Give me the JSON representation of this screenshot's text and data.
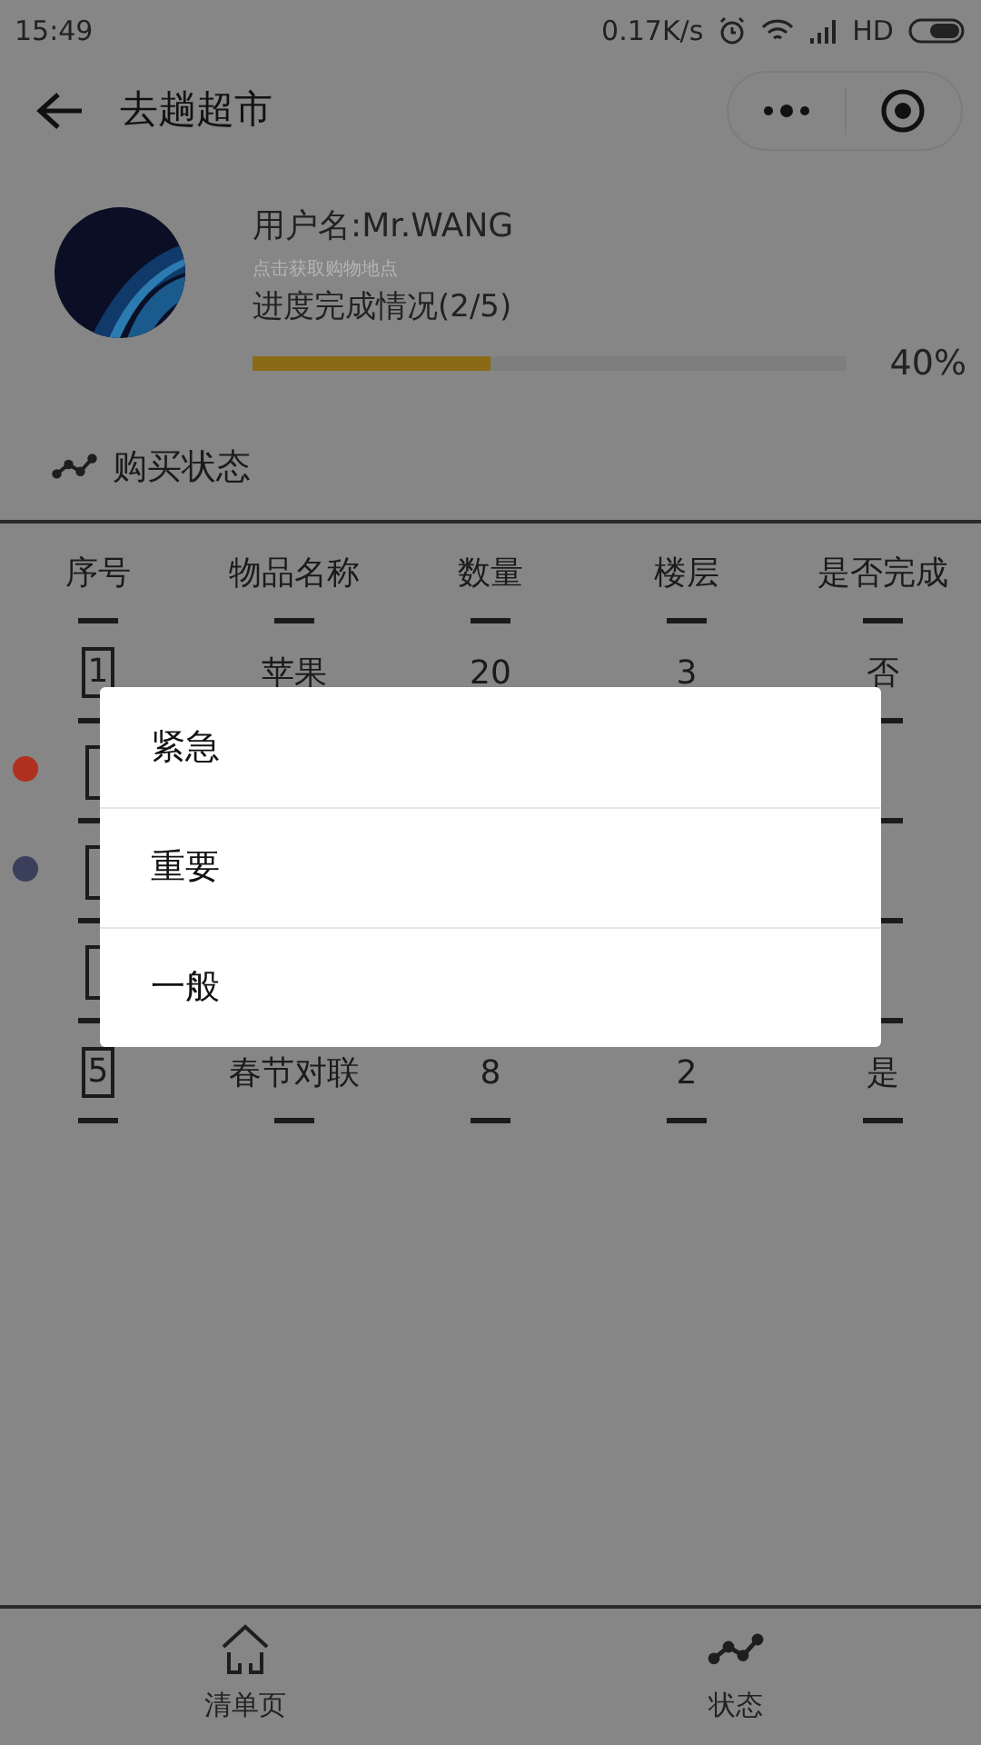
{
  "status_bar": {
    "time": "15:49",
    "speed": "0.17K/s",
    "network": "HD"
  },
  "nav": {
    "title": "去趟超市"
  },
  "profile": {
    "username": "用户名:Mr.WANG",
    "hint": "点击获取购物地点",
    "progress_label": "进度完成情况(2/5)",
    "level": 0.4,
    "percent": "40%"
  },
  "section": {
    "title": "购买状态"
  },
  "table": {
    "columns": [
      "序号",
      "物品名称",
      "数量",
      "楼层",
      "是否完成"
    ],
    "rows": [
      {
        "kind": "item",
        "index": "1",
        "name": "苹果",
        "qty": "20",
        "floor": "3",
        "done": "否"
      },
      {
        "kind": "covered",
        "color": "#b03020"
      },
      {
        "kind": "covered",
        "color": "#3a3f5c"
      },
      {
        "kind": "covered"
      },
      {
        "kind": "item",
        "index": "5",
        "name": "春节对联",
        "qty": "8",
        "floor": "2",
        "done": "是"
      }
    ]
  },
  "menu": {
    "items": [
      "紧急",
      "重要",
      "一般"
    ]
  },
  "tabs": [
    {
      "label": "清单页",
      "kind": "home"
    },
    {
      "label": "状态",
      "kind": "chart"
    }
  ]
}
